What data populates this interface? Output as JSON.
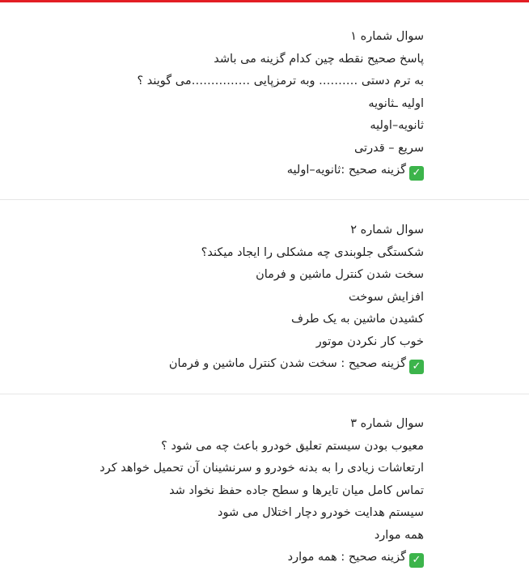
{
  "colors": {
    "top_bar": "#e31e24",
    "check_badge": "#3cb44b"
  },
  "questions": [
    {
      "title": "سوال شماره ۱",
      "prompt_line1": "پاسخ صحیح نقطه چین کدام گزینه می باشد",
      "prompt_line2": "به ترم دستی ………. وبه ترمزپایی ……………می گویند ؟",
      "options": [
        "اولیه ـثانویه",
        "ثانویه–اولیه",
        "سریع – قدرتی"
      ],
      "answer": "گزینه صحیح :ثانویه–اولیه",
      "answer_icon": "check-mark-icon"
    },
    {
      "title": "سوال شماره ۲",
      "prompt_line1": "شکستگی جلوبندی چه مشکلی را ایجاد میکند؟",
      "options": [
        "سخت شدن کنترل ماشین و فرمان",
        "افزایش سوخت",
        "کشیدن ماشین به یک طرف",
        "خوب کار نکردن موتور"
      ],
      "answer": "گزینه صحیح : سخت شدن کنترل ماشین و فرمان",
      "answer_icon": "check-mark-icon"
    },
    {
      "title": "سوال شماره ۳",
      "prompt_line1": "معیوب بودن سیستم تعلیق خودرو باعث چه می شود ؟",
      "options": [
        "ارتعاشات زیادی را به بدنه خودرو و سرنشینان آن تحمیل خواهد کرد",
        "تماس کامل میان تایرها و سطح جاده حفظ نخواد شد",
        "سیستم هدایت خودرو دچار اختلال می شود",
        "همه موارد"
      ],
      "answer": "گزینه صحیح : همه موارد",
      "answer_icon": "check-mark-icon"
    }
  ]
}
